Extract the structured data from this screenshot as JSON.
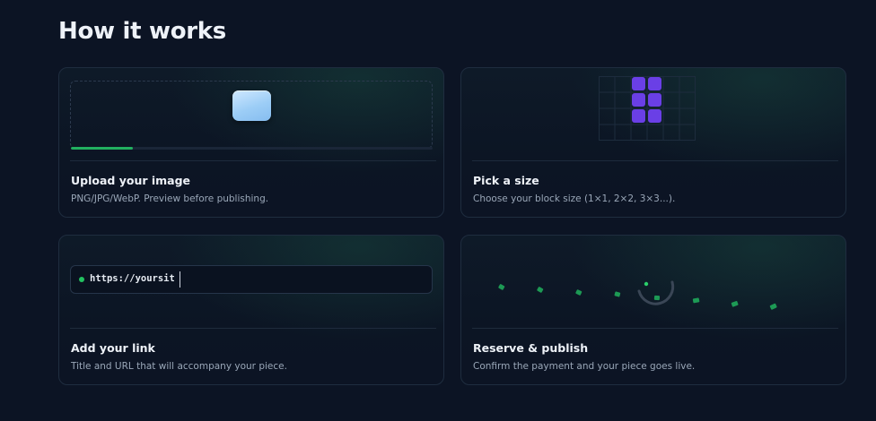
{
  "section": {
    "title": "How it works"
  },
  "steps": [
    {
      "title": "Upload your image",
      "description": "PNG/JPG/WebP. Preview before publishing.",
      "upload_progress_percent": 17
    },
    {
      "title": "Pick a size",
      "description": "Choose your block size (1×1, 2×2, 3×3...)."
    },
    {
      "title": "Add your link",
      "description": "Title and URL that will accompany your piece.",
      "url_value": "https://yoursit"
    },
    {
      "title": "Reserve & publish",
      "description": "Confirm the payment and your piece goes live."
    }
  ],
  "colors": {
    "accent_green": "#22b060",
    "block_purple": "#6a3fe6",
    "card_border": "#1f2d3f",
    "background": "#0c1424"
  }
}
